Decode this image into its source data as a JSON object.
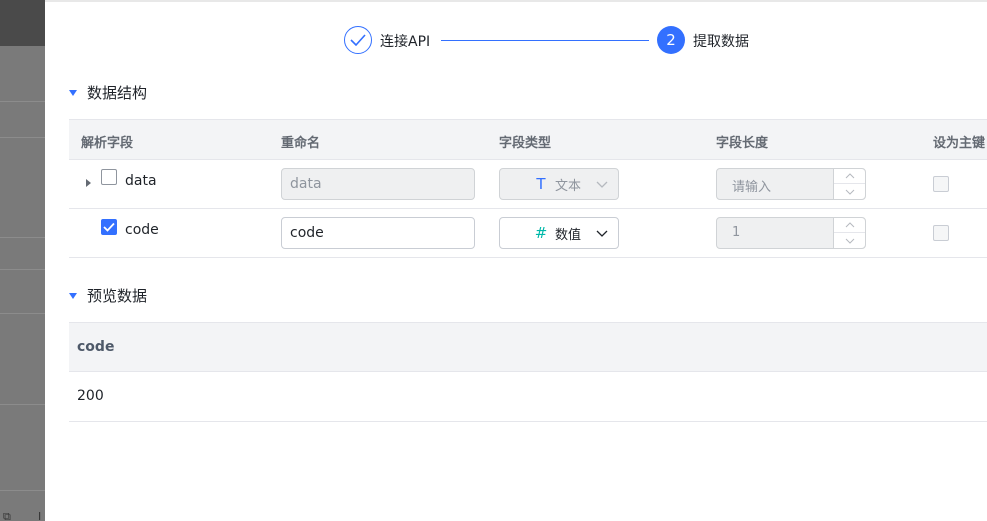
{
  "steps": [
    {
      "index": "1",
      "label": "连接API",
      "status": "done"
    },
    {
      "index": "2",
      "label": "提取数据",
      "status": "active"
    }
  ],
  "structure": {
    "title": "数据结构",
    "columns": [
      "解析字段",
      "重命名",
      "字段类型",
      "字段长度",
      "设为主键"
    ],
    "rows": [
      {
        "field": "data",
        "checked": false,
        "expandable": true,
        "rename": "data",
        "type_icon": "T",
        "type_icon_name": "text-type-icon",
        "type": "文本",
        "length": "请输入",
        "disabled": true
      },
      {
        "field": "code",
        "checked": true,
        "expandable": false,
        "rename": "code",
        "type_icon": "#",
        "type_icon_name": "number-type-icon",
        "type": "数值",
        "length": "1",
        "disabled": false
      }
    ]
  },
  "preview": {
    "title": "预览数据",
    "columns": [
      "code"
    ],
    "rows": [
      [
        "200"
      ]
    ]
  },
  "colors": {
    "accent": "#3370ff",
    "number_icon": "#00b8a9"
  }
}
